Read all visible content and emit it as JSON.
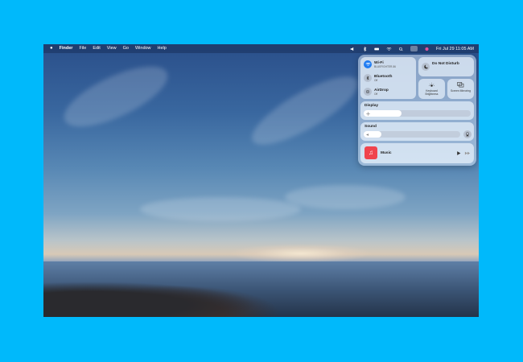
{
  "menubar": {
    "apple_icon": "apple-icon",
    "items": [
      "Finder",
      "File",
      "Edit",
      "View",
      "Go",
      "Window",
      "Help"
    ],
    "datetime": "Fri Jul 29  11:05 AM"
  },
  "control_center": {
    "wifi": {
      "title": "Wi-Fi",
      "subtitle": "BLUEFIGHTER-56"
    },
    "bluetooth": {
      "title": "Bluetooth",
      "subtitle": "Off"
    },
    "airdrop": {
      "title": "AirDrop",
      "subtitle": "Off"
    },
    "dnd": {
      "title": "Do Not Disturb"
    },
    "keyboard_brightness": {
      "label": "Keyboard Brightness"
    },
    "screen_mirroring": {
      "label": "Screen Mirroring"
    },
    "display": {
      "label": "Display",
      "level": 0.35
    },
    "sound": {
      "label": "Sound",
      "level": 0.18
    },
    "now_playing": {
      "app": "Music"
    }
  },
  "colors": {
    "background": "#00b9fb",
    "accent": "#1f7cf2",
    "music_red": "#f0444d"
  }
}
